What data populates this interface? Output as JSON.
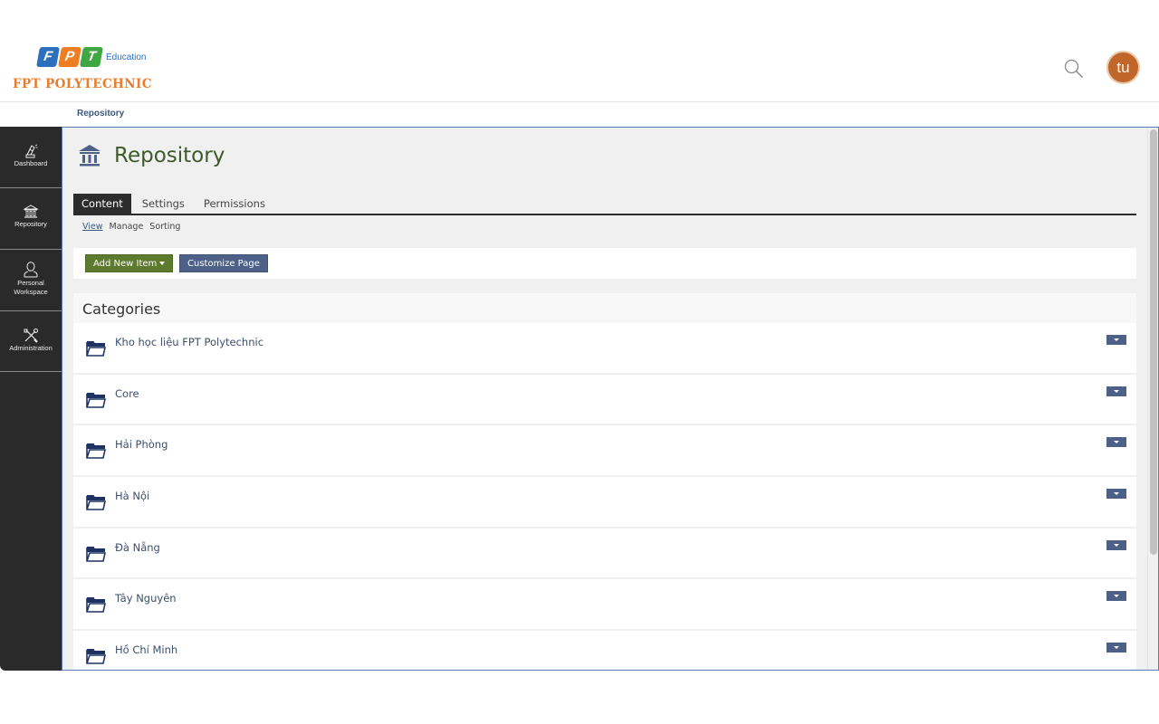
{
  "header": {
    "logo": {
      "letters": [
        "F",
        "P",
        "T"
      ],
      "tagline": "Education",
      "brand": "FPT POLYTECHNIC"
    },
    "search_icon": "search-icon",
    "avatar_initials": "tu"
  },
  "breadcrumb": "Repository",
  "sidebar": {
    "items": [
      {
        "label": "Dashboard",
        "icon": "dashboard-icon"
      },
      {
        "label": "Repository",
        "icon": "bank-icon"
      },
      {
        "label_line1": "Personal",
        "label_line2": "Workspace",
        "icon": "user-icon"
      },
      {
        "label": "Administration",
        "icon": "tools-icon"
      }
    ]
  },
  "page": {
    "title": "Repository",
    "tabs": [
      {
        "label": "Content",
        "active": true
      },
      {
        "label": "Settings",
        "active": false
      },
      {
        "label": "Permissions",
        "active": false
      }
    ],
    "subtabs": [
      {
        "label": "View",
        "active": true
      },
      {
        "label": "Manage",
        "active": false
      },
      {
        "label": "Sorting",
        "active": false
      }
    ],
    "toolbar": {
      "add_label": "Add New Item",
      "customize_label": "Customize Page"
    },
    "categories": {
      "title": "Categories",
      "items": [
        "Kho học liệu FPT Polytechnic",
        "Core",
        "Hải Phòng",
        "Hà Nội",
        "Đà Nẵng",
        "Tây Nguyên",
        "Hồ Chí Minh"
      ]
    }
  },
  "colors": {
    "primary_button": "#5d7a2e",
    "secondary_button": "#4d6087",
    "title": "#3d5a2a",
    "avatar": "#c0662b",
    "sidebar": "#2a2a2a"
  }
}
